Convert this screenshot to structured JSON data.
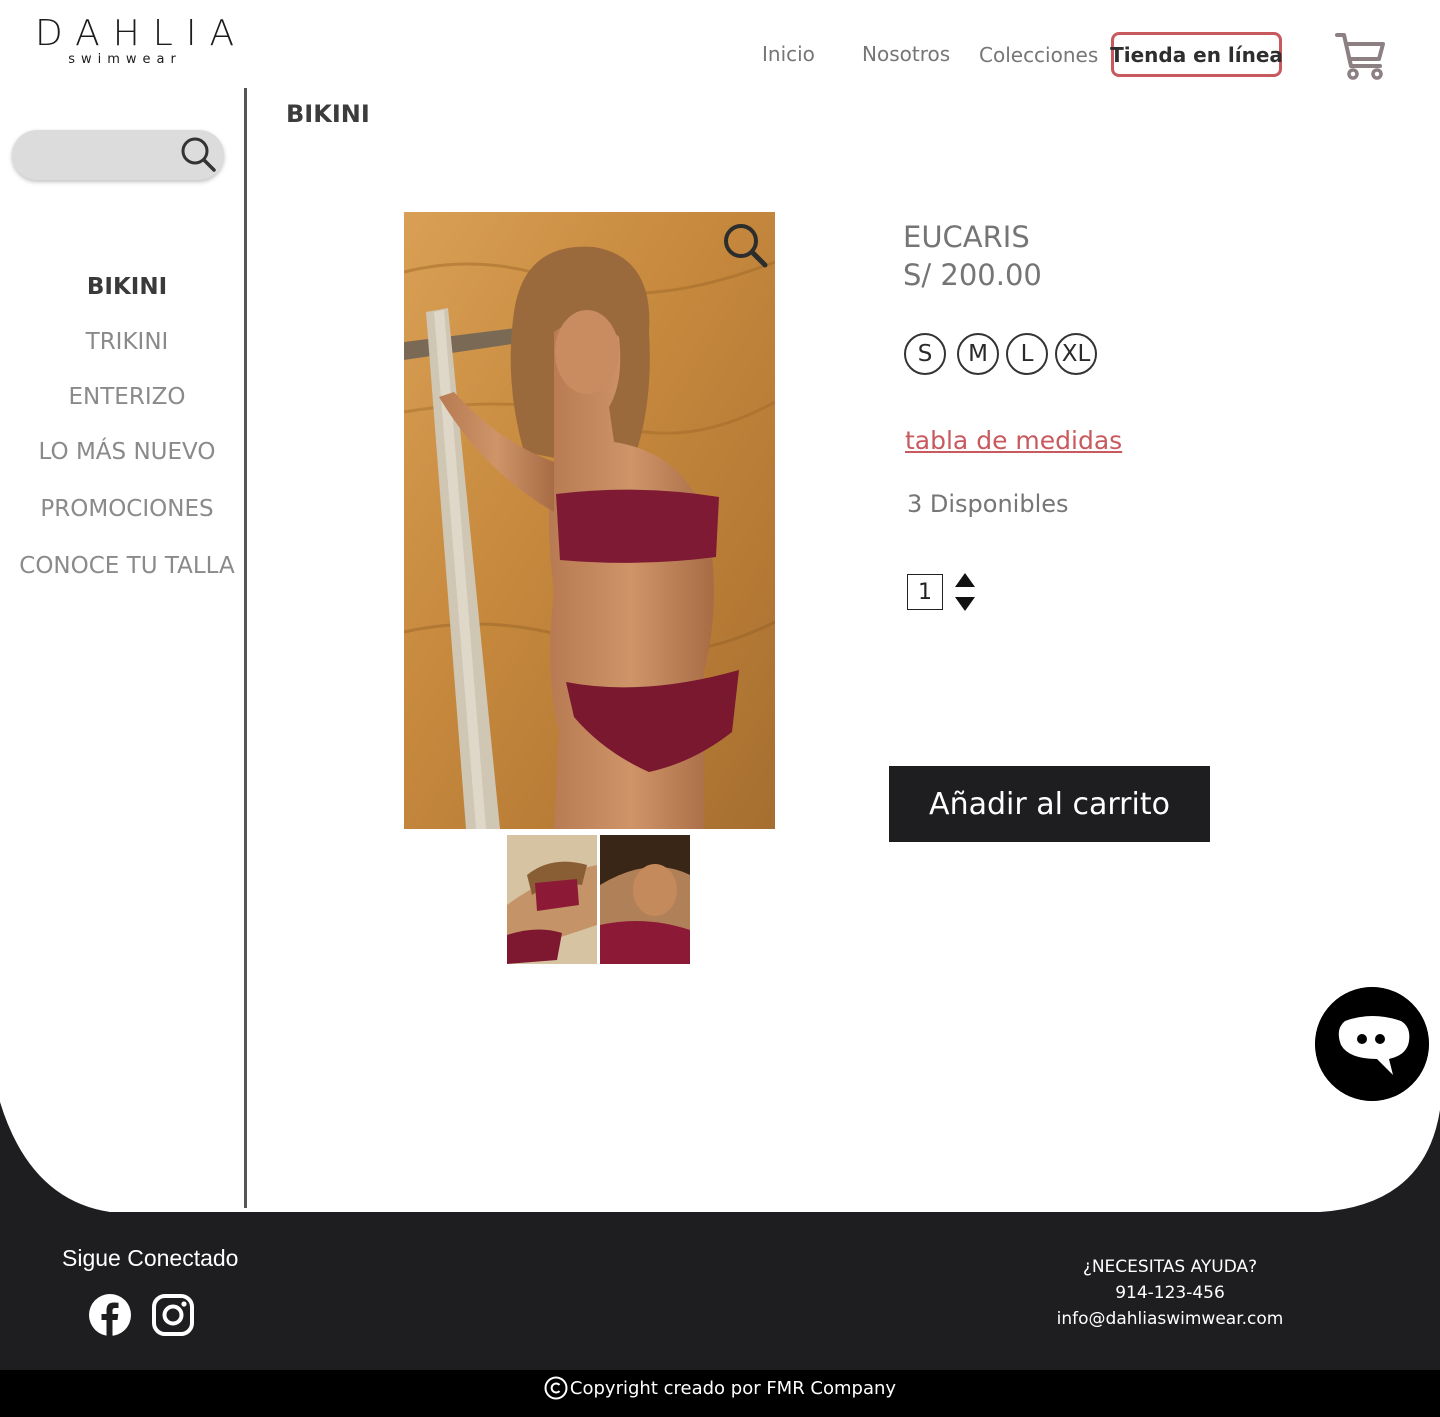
{
  "brand": {
    "name": "DAHLIA",
    "tagline": "swimwear"
  },
  "nav": {
    "items": [
      "Inicio",
      "Nosotros",
      "Colecciones"
    ],
    "active": "Tienda en línea"
  },
  "sidebar": {
    "categories": [
      {
        "label": "BIKINI",
        "active": true
      },
      {
        "label": "TRIKINI",
        "active": false
      },
      {
        "label": "ENTERIZO",
        "active": false
      },
      {
        "label": "LO MÁS NUEVO",
        "active": false
      },
      {
        "label": "PROMOCIONES",
        "active": false
      },
      {
        "label": "CONOCE TU TALLA",
        "active": false
      }
    ]
  },
  "page": {
    "title": "BIKINI"
  },
  "product": {
    "name": "EUCARIS",
    "price": "S/ 200.00",
    "sizes": [
      "S",
      "M",
      "L",
      "XL"
    ],
    "size_chart_link": "tabla de medidas",
    "stock": "3 Disponibles",
    "quantity": "1",
    "add_to_cart": "Añadir al carrito"
  },
  "footer": {
    "follow": "Sigue Conectado",
    "social": [
      "facebook-icon",
      "instagram-icon"
    ],
    "help_title": "¿NECESITAS AYUDA?",
    "phone": "914-123-456",
    "email": "info@dahliaswimwear.com",
    "copyright": "Copyright creado por FMR Company"
  },
  "colors": {
    "accent": "#c8595e",
    "button": "#1e1d1f",
    "footer": "#1e1d1f",
    "copyright_bar": "#000000"
  }
}
